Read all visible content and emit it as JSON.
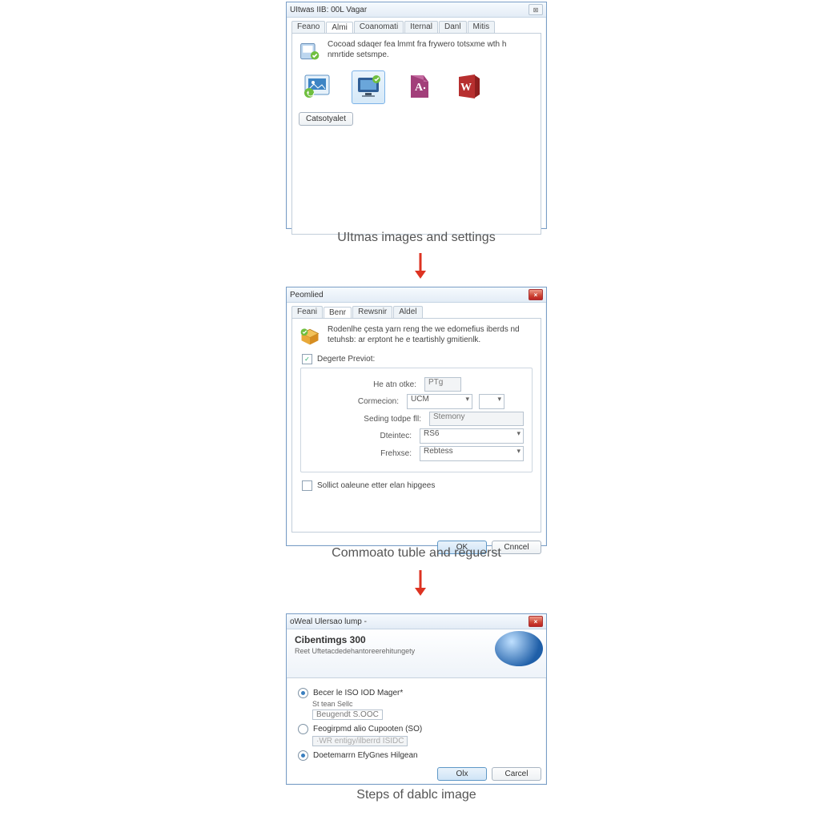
{
  "dlg1": {
    "title": "UItwas IIB: 00L Vagar",
    "winbtn_close": "⊠",
    "tabs": [
      "Feano",
      "Almi",
      "Coanomati",
      "Iternal",
      "Danl",
      "Mitis"
    ],
    "activeTabIndex": 1,
    "desc": "Cocoad sdaqer fea lmmt fra frywero totsxme wth h nmrtide setsmpe.",
    "catalogBtn": "Catsotyalet",
    "caption": "UItmas images and settings"
  },
  "dlg2": {
    "title": "Peomlied",
    "tabs": [
      "Feani",
      "Benr",
      "Rewsnir",
      "Aldel"
    ],
    "activeTabIndex": 1,
    "desc": "Rodenlhe çesta yarn reng the we edomefius iberds nd tetuhsb: ar erptont he e teartishly gmitienlk.",
    "legend": "Degerte Previot:",
    "rows": {
      "healn": {
        "label": "He atn otke:",
        "value": "PTg"
      },
      "conn": {
        "label": "Cormecion:",
        "value": "UCM"
      },
      "saving": {
        "label": "Seding todpe fll:",
        "value": "Stemony"
      },
      "delete": {
        "label": "Dteintec:",
        "value": "RS6"
      },
      "prefix": {
        "label": "Frehxse:",
        "value": "Rebtess"
      }
    },
    "checkbox": "Sollict oaleune etter elan hipgees",
    "ok": "OK",
    "cancel": "Cnncel",
    "caption": "Commoato tuble and reguerst"
  },
  "dlg3": {
    "title": "oWeal Ulersao lump -",
    "heading": "Cibentimgs 300",
    "sub": "Reet Uftetacdedehantoreerehitungety",
    "opt1": {
      "label": "Becer le ISO IOD Mager*",
      "sub": "St tean Sellc",
      "value": "Beugendt S.OOC"
    },
    "opt2": {
      "label": "Feogirpmd alio Cupooten (SO)",
      "value": "·WR entigy/ilberrd ISIDC"
    },
    "opt3": {
      "label": "Doetemarrn EfyGnes Hilgean"
    },
    "ok": "Olx",
    "cancel": "Carcel",
    "caption": "Steps of dablc image"
  }
}
